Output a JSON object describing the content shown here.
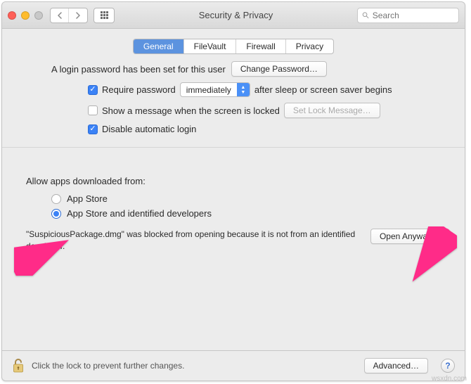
{
  "titlebar": {
    "title": "Security & Privacy",
    "search_placeholder": "Search"
  },
  "tabs": {
    "general": "General",
    "filevault": "FileVault",
    "firewall": "Firewall",
    "privacy": "Privacy"
  },
  "login": {
    "password_set": "A login password has been set for this user",
    "change_password": "Change Password…",
    "require_password": "Require password",
    "require_delay": "immediately",
    "after_sleep": "after sleep or screen saver begins",
    "show_message": "Show a message when the screen is locked",
    "set_lock_message": "Set Lock Message…",
    "disable_auto_login": "Disable automatic login"
  },
  "downloads": {
    "label": "Allow apps downloaded from:",
    "app_store": "App Store",
    "app_store_identified": "App Store and identified developers",
    "blocked_message": "\"SuspiciousPackage.dmg\" was blocked from opening because it is not from an identified developer.",
    "open_anyway": "Open Anyway"
  },
  "footer": {
    "lock_msg": "Click the lock to prevent further changes.",
    "advanced": "Advanced…"
  },
  "watermark": "wsxdn.com"
}
